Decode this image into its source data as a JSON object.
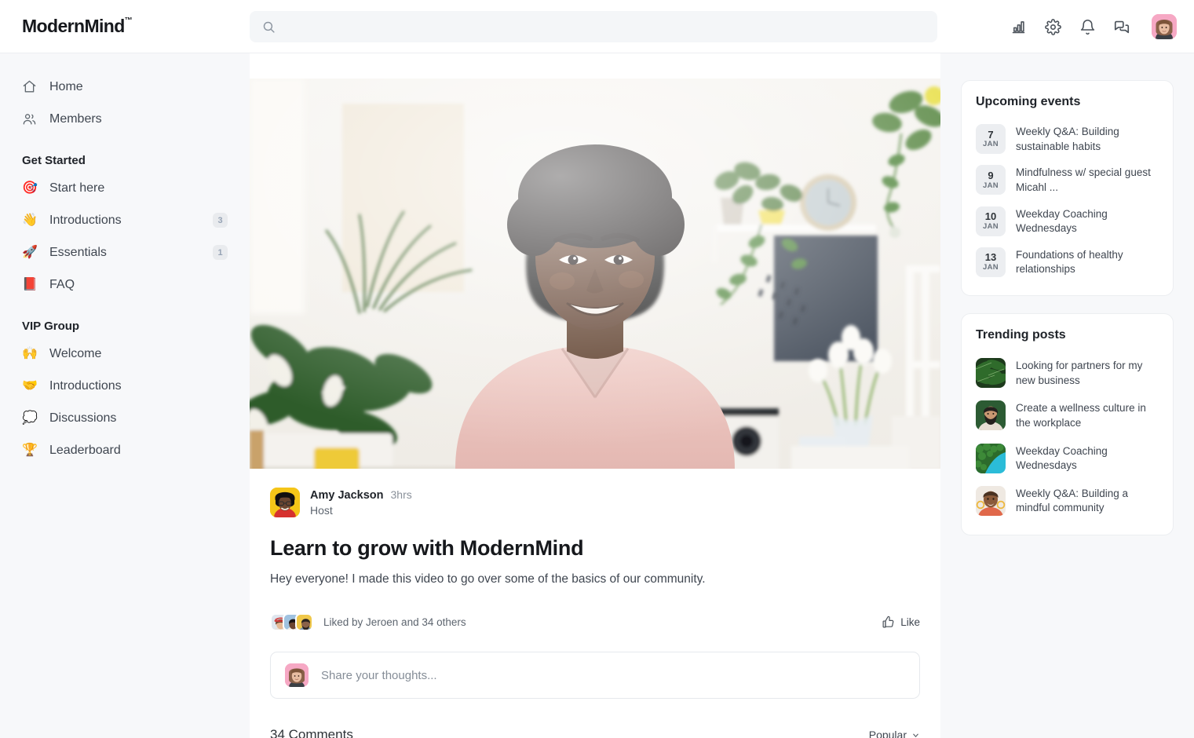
{
  "header": {
    "logo": "ModernMind",
    "logo_tm": "™",
    "search_placeholder": "",
    "search_value": "",
    "icons": [
      "analytics-icon",
      "gear-icon",
      "bell-icon",
      "messages-icon"
    ],
    "avatar": "user-avatar"
  },
  "sidebar": {
    "top_items": [
      {
        "icon": "home-icon",
        "label": "Home",
        "badge": ""
      },
      {
        "icon": "members-icon",
        "label": "Members",
        "badge": ""
      }
    ],
    "groups": [
      {
        "title": "Get Started",
        "items": [
          {
            "icon": "🎯",
            "icon_name": "target-emoji",
            "label": "Start here",
            "badge": ""
          },
          {
            "icon": "👋",
            "icon_name": "wave-emoji",
            "label": "Introductions",
            "badge": "3"
          },
          {
            "icon": "🚀",
            "icon_name": "rocket-emoji",
            "label": "Essentials",
            "badge": "1"
          },
          {
            "icon": "📕",
            "icon_name": "book-emoji",
            "label": "FAQ",
            "badge": ""
          }
        ]
      },
      {
        "title": "VIP Group",
        "items": [
          {
            "icon": "🙌",
            "icon_name": "raised-hands-emoji",
            "label": "Welcome",
            "badge": ""
          },
          {
            "icon": "🤝",
            "icon_name": "handshake-emoji",
            "label": "Introductions",
            "badge": ""
          },
          {
            "icon": "💭",
            "icon_name": "thought-balloon-emoji",
            "label": "Discussions",
            "badge": ""
          },
          {
            "icon": "🏆",
            "icon_name": "trophy-emoji",
            "label": "Leaderboard",
            "badge": ""
          }
        ]
      }
    ]
  },
  "post": {
    "author_name": "Amy Jackson",
    "time": "3hrs",
    "role": "Host",
    "title": "Learn to grow with ModernMind",
    "text": "Hey everyone! I made this video to go over some of the basics of our community.",
    "likes_text": "Liked by Jeroen and 34 others",
    "like_label": "Like",
    "comment_placeholder": "Share your thoughts...",
    "comments_count": "34 Comments",
    "sort_label": "Popular"
  },
  "rail": {
    "events_title": "Upcoming events",
    "events": [
      {
        "day": "7",
        "month": "JAN",
        "title": "Weekly Q&A: Building sustainable habits"
      },
      {
        "day": "9",
        "month": "JAN",
        "title": "Mindfulness w/ special guest Micahl ..."
      },
      {
        "day": "10",
        "month": "JAN",
        "title": "Weekday Coaching Wednesdays"
      },
      {
        "day": "13",
        "month": "JAN",
        "title": "Foundations of healthy relationships"
      }
    ],
    "trending_title": "Trending posts",
    "trending": [
      {
        "thumb": "fern-leaves-thumb",
        "title": "Looking for partners for my new business"
      },
      {
        "thumb": "bearded-man-thumb",
        "title": "Create a wellness culture in the workplace"
      },
      {
        "thumb": "aerial-forest-water-thumb",
        "title": "Weekday Coaching Wednesdays"
      },
      {
        "thumb": "smiling-woman-thumb",
        "title": "Weekly Q&A: Building a mindful community"
      }
    ]
  },
  "colors": {
    "page_bg": "#f7f8fa",
    "card_bg": "#ffffff",
    "border": "#eceef1",
    "text_primary": "#20242a",
    "text_secondary": "#5d656f",
    "badge_bg": "#e9ebee",
    "badge_text": "#96a3b5"
  }
}
